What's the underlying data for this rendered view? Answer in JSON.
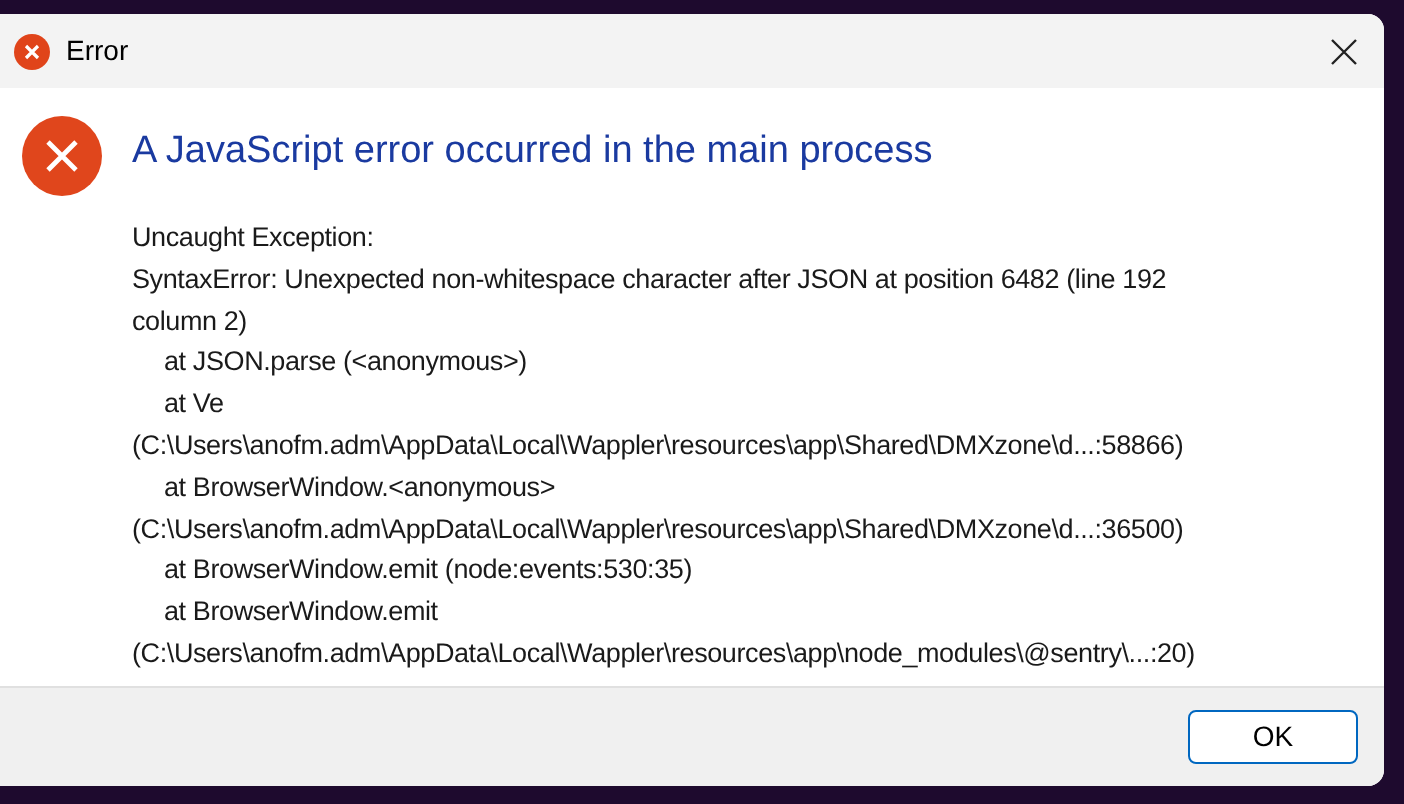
{
  "window": {
    "title": "Error"
  },
  "heading": "A JavaScript error occurred in the main process",
  "message_lines": [
    {
      "kind": "plain",
      "text": "Uncaught Exception:"
    },
    {
      "kind": "plain",
      "text": "SyntaxError: Unexpected non-whitespace character after JSON at position 6482 (line 192"
    },
    {
      "kind": "plain",
      "text": "column 2)"
    },
    {
      "kind": "frame",
      "text": "at JSON.parse (<anonymous>)"
    },
    {
      "kind": "frame",
      "text": "at Ve"
    },
    {
      "kind": "plain",
      "text": "(C:\\Users\\anofm.adm\\AppData\\Local\\Wappler\\resources\\app\\Shared\\DMXzone\\d...:58866)"
    },
    {
      "kind": "frame",
      "text": "at BrowserWindow.<anonymous>"
    },
    {
      "kind": "plain",
      "text": "(C:\\Users\\anofm.adm\\AppData\\Local\\Wappler\\resources\\app\\Shared\\DMXzone\\d...:36500)"
    },
    {
      "kind": "frame",
      "text": "at BrowserWindow.emit (node:events:530:35)"
    },
    {
      "kind": "frame",
      "text": "at BrowserWindow.emit"
    },
    {
      "kind": "plain",
      "text": "(C:\\Users\\anofm.adm\\AppData\\Local\\Wappler\\resources\\app\\node_modules\\@sentry\\...:20)"
    }
  ],
  "buttons": [
    {
      "label": "OK"
    }
  ]
}
